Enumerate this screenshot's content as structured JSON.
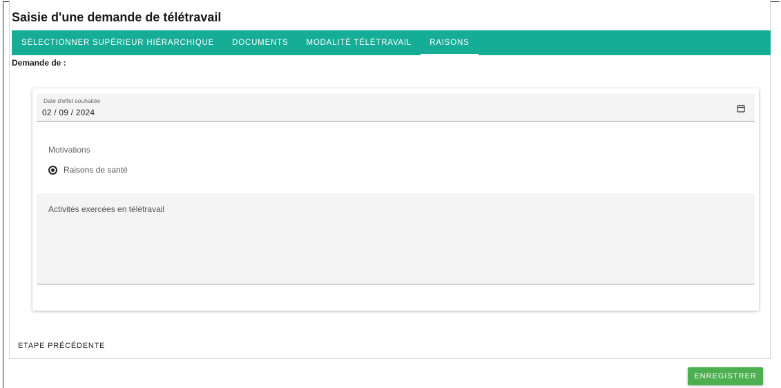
{
  "page": {
    "title": "Saisie d'une demande de télétravail"
  },
  "tabs": [
    {
      "label": "SÉLECTIONNER SUPÉRIEUR HIÉRARCHIQUE",
      "active": false
    },
    {
      "label": "DOCUMENTS",
      "active": false
    },
    {
      "label": "MODALITÉ TÉLÉTRAVAIL",
      "active": false
    },
    {
      "label": "RAISONS",
      "active": true
    }
  ],
  "form": {
    "demande_label": "Demande de :",
    "date_label": "Date d'effet souhaitée",
    "date_value": "02 / 09 / 2024",
    "motivations_label": "Motivations",
    "motivation_option": "Raisons de santé",
    "motivation_selected": true,
    "activities_label": "Activités exercées en télétravail",
    "activities_value": ""
  },
  "actions": {
    "prev_label": "ETAPE PRÉCÉDENTE",
    "save_label": "ENREGISTRER"
  },
  "colors": {
    "tabs_bg": "#16ad96",
    "save_button": "#4caf50"
  },
  "icons": {
    "date_picker": "calendar-icon"
  }
}
